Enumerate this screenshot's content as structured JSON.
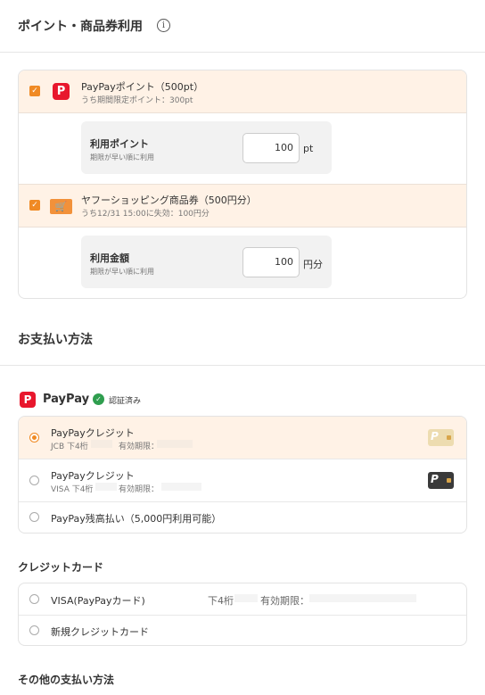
{
  "points_section": {
    "title": "ポイント・商品券利用",
    "info_icon": "i",
    "paypay": {
      "title": "PayPayポイント（500pt）",
      "sub": "うち期間限定ポイント：300pt",
      "field_label": "利用ポイント",
      "field_sub": "期限が早い順に利用",
      "value": "100",
      "unit": "pt"
    },
    "coupon": {
      "title": "ヤフーショッピング商品券（500円分）",
      "sub": "うち12/31 15:00に失効：100円分",
      "field_label": "利用金額",
      "field_sub": "期限が早い順に利用",
      "value": "100",
      "unit": "円分"
    }
  },
  "payment_section": {
    "title": "お支払い方法",
    "paypay_brand": "PayPay",
    "verified_label": "認証済み",
    "paypay_options": [
      {
        "title": "PayPayクレジット",
        "sub_prefix": "JCB 下4桁",
        "expiry_label": "有効期限："
      },
      {
        "title": "PayPayクレジット",
        "sub_prefix": "VISA 下4桁",
        "expiry_label": "有効期限："
      },
      {
        "title": "PayPay残高払い（5,000円利用可能）"
      }
    ]
  },
  "credit_section": {
    "title": "クレジットカード",
    "options": [
      {
        "title": "VISA(PayPayカード)",
        "last4_label": "下4桁",
        "expiry_label": "有効期限："
      },
      {
        "title": "新規クレジットカード"
      }
    ]
  },
  "other_section": {
    "title": "その他の支払い方法"
  },
  "colors": {
    "accent": "#f08a24",
    "highlight_bg": "#fff2e6",
    "paypay_red": "#e8172d",
    "verified_green": "#2f9e4f"
  }
}
